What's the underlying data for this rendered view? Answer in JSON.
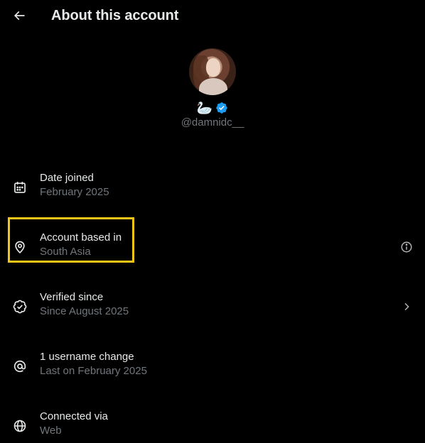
{
  "header": {
    "title": "About this account"
  },
  "profile": {
    "display_name": "🦢",
    "verified": true,
    "handle": "@damnidc__"
  },
  "rows": [
    {
      "icon": "calendar-icon",
      "primary": "Date joined",
      "secondary": "February 2025"
    },
    {
      "icon": "location-pin-icon",
      "primary": "Account based in",
      "secondary": "South Asia",
      "trailing": "info-icon",
      "highlighted": true
    },
    {
      "icon": "verified-badge-icon",
      "primary": "Verified since",
      "secondary": "Since August 2025",
      "trailing": "chevron-right-icon"
    },
    {
      "icon": "at-icon",
      "primary": "1 username change",
      "secondary": "Last on February 2025"
    },
    {
      "icon": "globe-icon",
      "primary": "Connected via",
      "secondary": "Web"
    }
  ],
  "colors": {
    "background": "#000000",
    "text_primary": "#e7e9ea",
    "text_secondary": "#71767b",
    "verified_blue": "#1d9bf0",
    "highlight": "#f5c518"
  }
}
